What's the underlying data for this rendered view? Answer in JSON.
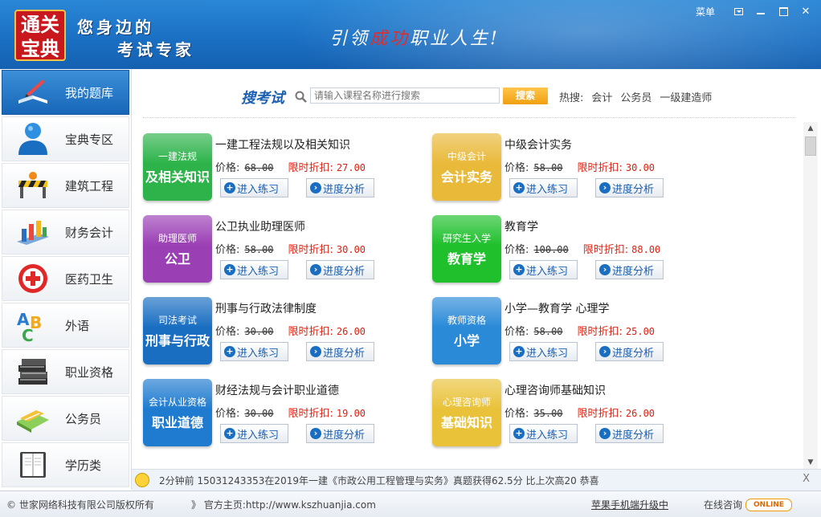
{
  "header": {
    "logo_line1": "通关",
    "logo_line2": "宝典",
    "slogan_line1": "您身边的",
    "slogan_line2": "考试专家",
    "banner_part1": "引领",
    "banner_highlight": "成功",
    "banner_part2": "职业人生!",
    "menu_label": "菜单"
  },
  "sidebar": {
    "items": [
      {
        "label": "我的题库",
        "icon": "book-pen-icon",
        "active": true
      },
      {
        "label": "宝典专区",
        "icon": "user-icon"
      },
      {
        "label": "建筑工程",
        "icon": "construction-barrier-icon"
      },
      {
        "label": "财务会计",
        "icon": "finance-chart-icon"
      },
      {
        "label": "医药卫生",
        "icon": "medical-cross-icon"
      },
      {
        "label": "外语",
        "icon": "abc-letters-icon"
      },
      {
        "label": "职业资格",
        "icon": "book-stack-icon"
      },
      {
        "label": "公务员",
        "icon": "calculator-icon"
      },
      {
        "label": "学历类",
        "icon": "notebook-icon"
      }
    ]
  },
  "search": {
    "title": "搜考试",
    "placeholder": "请输入课程名称进行搜索",
    "button": "搜索",
    "hot_label": "热搜:",
    "hot_keywords": [
      "会计",
      "公务员",
      "一级建造师"
    ]
  },
  "course_labels": {
    "price_label": "价格:",
    "discount_label": "限时折扣:",
    "practice_button": "进入练习",
    "progress_button": "进度分析"
  },
  "courses": [
    {
      "title": "一建工程法规以及相关知识",
      "original_price": "68.00",
      "discount_price": "27.00",
      "thumb_line1": "一建法规",
      "thumb_line2": "及相关知识",
      "color": "#2db34a"
    },
    {
      "title": "中级会计实务",
      "original_price": "58.00",
      "discount_price": "30.00",
      "thumb_line1": "中级会计",
      "thumb_line2": "会计实务",
      "color": "#e9b93a"
    },
    {
      "title": "公卫执业助理医师",
      "original_price": "58.00",
      "discount_price": "30.00",
      "thumb_line1": "助理医师",
      "thumb_line2": "公卫",
      "color": "#9b3fb5"
    },
    {
      "title": "教育学",
      "original_price": "100.00",
      "discount_price": "88.00",
      "thumb_line1": "研究生入学",
      "thumb_line2": "教育学",
      "color": "#1fc02c"
    },
    {
      "title": "刑事与行政法律制度",
      "original_price": "30.00",
      "discount_price": "26.00",
      "thumb_line1": "司法考试",
      "thumb_line2": "刑事与行政",
      "color": "#1a6ec2"
    },
    {
      "title": "小学—教育学 心理学",
      "original_price": "58.00",
      "discount_price": "25.00",
      "thumb_line1": "教师资格",
      "thumb_line2": "小学",
      "color": "#2a8ad8"
    },
    {
      "title": "财经法规与会计职业道德",
      "original_price": "30.00",
      "discount_price": "19.00",
      "thumb_line1": "会计从业资格",
      "thumb_line2": "职业道德",
      "color": "#1f7bd0"
    },
    {
      "title": "心理咨询师基础知识",
      "original_price": "35.00",
      "discount_price": "26.00",
      "thumb_line1": "心理咨询师",
      "thumb_line2": "基础知识",
      "color": "#e9c23a"
    }
  ],
  "ticker": {
    "message": "2分钟前 15031243353在2019年一建《市政公用工程管理与实务》真题获得62.5分 比上次高20 恭喜",
    "close": "X"
  },
  "footer": {
    "copyright": "© 世家网络科技有限公司版权所有",
    "site_label": "》 官方主页:http://www.kszhuanjia.com",
    "upgrade": "苹果手机端升级中",
    "consult": "在线咨询",
    "online_badge": "ONLINE"
  }
}
